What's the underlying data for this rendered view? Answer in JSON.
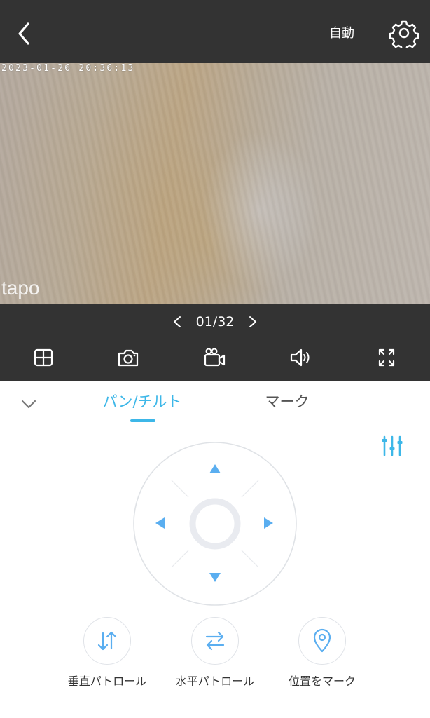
{
  "header": {
    "mode_label": "自動",
    "back_icon": "chevron-left-icon",
    "settings_icon": "gear-icon"
  },
  "video": {
    "timestamp": "2023-01-26 20:36:13",
    "watermark": "tapo"
  },
  "pager": {
    "text": "01/32",
    "prev_icon": "chevron-left-icon",
    "next_icon": "chevron-right-icon"
  },
  "controls": [
    {
      "name": "layout-grid-icon"
    },
    {
      "name": "camera-icon"
    },
    {
      "name": "video-record-icon"
    },
    {
      "name": "speaker-icon"
    },
    {
      "name": "fullscreen-icon"
    }
  ],
  "tabs": {
    "pan_tilt": "パン/チルト",
    "mark": "マーク",
    "active": "pan_tilt",
    "collapse_icon": "chevron-down-icon"
  },
  "filter_icon": "sliders-icon",
  "actions": [
    {
      "label": "垂直パトロール",
      "icon": "vertical-arrows-icon"
    },
    {
      "label": "水平パトロール",
      "icon": "horizontal-arrows-icon"
    },
    {
      "label": "位置をマーク",
      "icon": "location-pin-icon"
    }
  ],
  "colors": {
    "accent": "#3db7e8",
    "dark_bar": "#333333",
    "joystick_arrow": "#5aaef0"
  }
}
